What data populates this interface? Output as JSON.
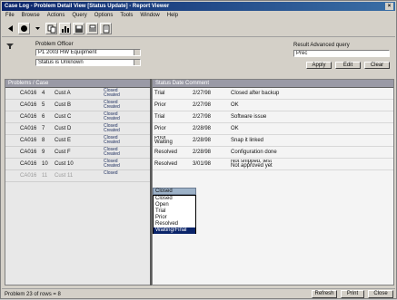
{
  "window": {
    "title": "Case Log - Problem Detail View [Status Update] - Report Viewer",
    "close_glyph": "×"
  },
  "menu": [
    "File",
    "Browse",
    "Actions",
    "Query",
    "Options",
    "Tools",
    "Window",
    "Help"
  ],
  "toolbar": {
    "icons": [
      "back-icon",
      "record-icon",
      "dropdown-arrow-icon",
      "copy-icon",
      "chart-icon",
      "save-icon",
      "print-icon",
      "document-icon"
    ]
  },
  "filter": {
    "problem_label": "Problem Officer",
    "problem_value": "P1 2003 HW Equipment",
    "second_value": "Status is Unknown",
    "search_label": "Result Advanced query",
    "search_value": "Prec",
    "buttons": [
      "Apply",
      "Edit",
      "Clear"
    ]
  },
  "left_grid": {
    "header": "Problems / Case",
    "rows": [
      {
        "id": "CA016",
        "n": "4",
        "name": "Cust A",
        "status": "Closed\nCreated"
      },
      {
        "id": "CA016",
        "n": "5",
        "name": "Cust B",
        "status": "Closed\nCreated"
      },
      {
        "id": "CA016",
        "n": "6",
        "name": "Cust C",
        "status": "Closed\nCreated"
      },
      {
        "id": "CA016",
        "n": "7",
        "name": "Cust D",
        "status": "Closed\nCreated"
      },
      {
        "id": "CA016",
        "n": "8",
        "name": "Cust E",
        "status": "Closed\nCreated"
      },
      {
        "id": "CA016",
        "n": "9",
        "name": "Cust F",
        "status": "Closed\nCreated"
      },
      {
        "id": "CA016",
        "n": "10",
        "name": "Cust 10",
        "status": "Closed\nCreated"
      },
      {
        "id": "CA016",
        "n": "11",
        "name": "Cust 11",
        "status": "Closed"
      }
    ]
  },
  "right_grid": {
    "header": "Status  Date  Comment",
    "rows": [
      {
        "status": "Trial",
        "date": "2/27/98",
        "comment": "Closed after backup"
      },
      {
        "status": "Prior",
        "date": "2/27/98",
        "comment": "OK"
      },
      {
        "status": "Trial",
        "date": "2/27/98",
        "comment": "Software issue"
      },
      {
        "status": "Prior",
        "date": "2/28/98",
        "comment": "OK"
      },
      {
        "status": "Prior\nWaiting",
        "date": "2/28/98",
        "comment": "Snap it linked"
      },
      {
        "status": "Resolved",
        "date": "2/28/98",
        "comment": "Configuration done"
      },
      {
        "status": "Resolved",
        "date": "3/01/98",
        "comment": "Not shipped, test\nNot approved yet"
      }
    ]
  },
  "dropdown": {
    "current": "Closed",
    "options": [
      "Closed",
      "Open",
      "Trial",
      "Prior",
      "Resolved",
      "Waiting/Final"
    ],
    "selected_index": 5
  },
  "status": {
    "text": "Problem 23 of rows = 8",
    "buttons": [
      "Refresh",
      "Print",
      "Close"
    ]
  }
}
